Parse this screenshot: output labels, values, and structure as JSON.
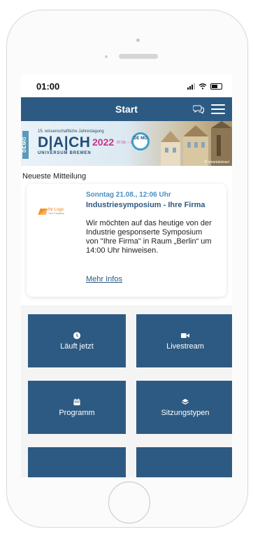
{
  "status_bar": {
    "time": "01:00"
  },
  "header": {
    "title": "Start",
    "chat_icon": "chat-bubbles-icon",
    "menu_icon": "hamburger-menu-icon",
    "color": "#2d5a82"
  },
  "banner": {
    "demo": "DEMO",
    "subtitle": "15. wissenschaftliche Jahrestagung",
    "main": "D|A|CH",
    "year": "2022",
    "dates": "07.03. – 10.03.",
    "venue": "UNIVERSUM BREMEN",
    "logo_text": "DE MO",
    "credit": "© smartabstract"
  },
  "latest": {
    "section_label": "Neueste Mitteilung",
    "logo_name": "Ihr Logo",
    "logo_tag": "Your Company",
    "date": "Sonntag 21.08., 12:06 Uhr",
    "title": "Industriesymposium - Ihre Firma",
    "body": "Wir möchten auf das heutige von der Industrie gesponserte Symposium von \"Ihre Firma\" in Raum „Berlin“ um 14:00 Uhr hinweisen.",
    "link": "Mehr Infos",
    "date_color": "#4a8ec2"
  },
  "tiles": [
    {
      "label": "Läuft jetzt",
      "icon": "clock-icon"
    },
    {
      "label": "Livestream",
      "icon": "video-camera-icon"
    },
    {
      "label": "Programm",
      "icon": "calendar-icon"
    },
    {
      "label": "Sitzungstypen",
      "icon": "layers-icon"
    }
  ]
}
